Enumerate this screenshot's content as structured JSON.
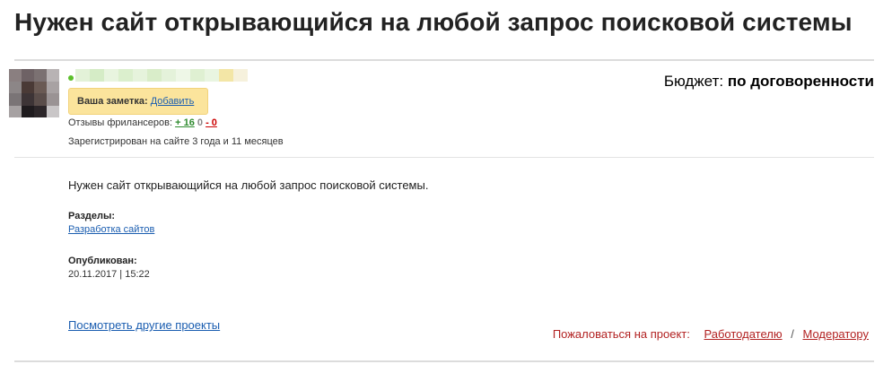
{
  "title": "Нужен сайт открывающийся на любой запрос поисковой системы",
  "budget": {
    "label": "Бюджет:",
    "value": "по договоренности"
  },
  "user": {
    "note_label": "Ваша заметка:",
    "note_add": "Добавить",
    "reviews_label": "Отзывы фрилансеров:",
    "reviews_positive": "+ 16",
    "reviews_neutral": "0",
    "reviews_negative": "- 0",
    "registered": "Зарегистрирован на сайте 3 года и 11 месяцев"
  },
  "project": {
    "description": "Нужен сайт открывающийся на любой запрос поисковой системы.",
    "sections_label": "Разделы:",
    "section_link": "Разработка сайтов",
    "published_label": "Опубликован:",
    "published_value": "20.11.2017 | 15:22"
  },
  "footer": {
    "other_projects": "Посмотреть другие проекты",
    "complain_label": "Пожаловаться на проект:",
    "complain_employer": "Работодателю",
    "complain_separator": "/",
    "complain_moderator": "Модератору"
  },
  "colors": {
    "link": "#1a5db0",
    "note_bg": "#fbe49c",
    "complain": "#b22222",
    "positive": "#2e8b2e",
    "negative": "#cc0000"
  }
}
